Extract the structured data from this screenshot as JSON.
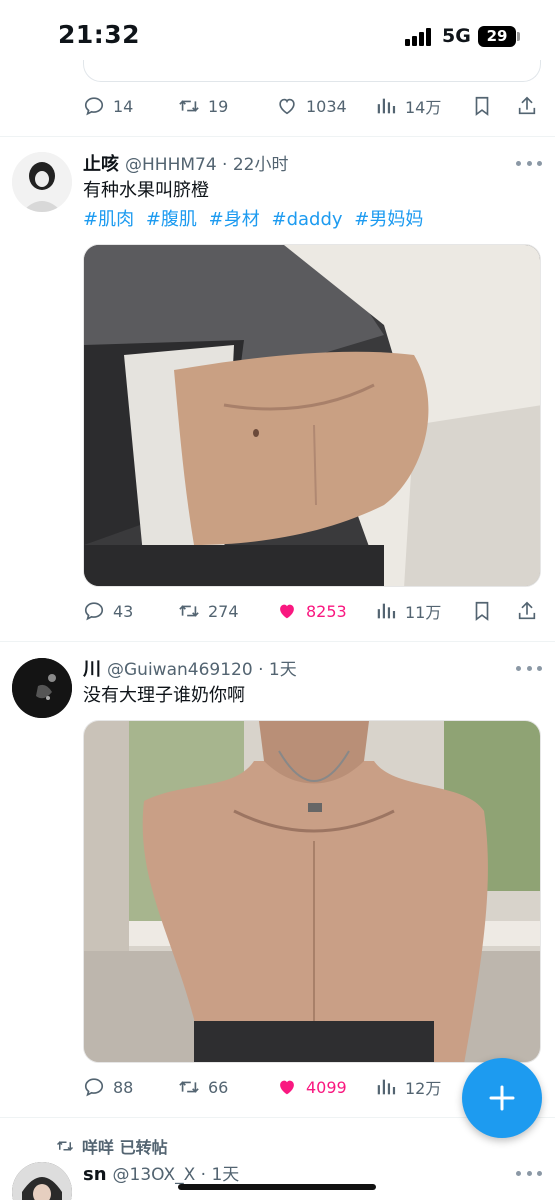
{
  "status_bar": {
    "time": "21:32",
    "network": "5G",
    "battery": "29"
  },
  "top_actions": {
    "replies": "14",
    "retweets": "19",
    "likes": "1034",
    "views": "14万"
  },
  "tweets": [
    {
      "author": "止咳",
      "meta": "@HHHM74 · 22小时",
      "text": "有种水果叫脐橙",
      "hashtags": [
        "#肌肉",
        "#腹肌",
        "#身材",
        "#daddy",
        "#男妈妈"
      ],
      "replies": "43",
      "retweets": "274",
      "likes": "8253",
      "views": "11万",
      "liked": true
    },
    {
      "author": "川",
      "meta": "@Guiwan469120 · 1天",
      "text": "没有大理子谁奶你啊",
      "replies": "88",
      "retweets": "66",
      "likes": "4099",
      "views": "12万",
      "liked": true
    },
    {
      "retweeted_by": "咩咩 已转帖",
      "author": "sn",
      "meta": "@13OX_X · 1天"
    }
  ],
  "colors": {
    "accent": "#1d9bf0",
    "like": "#f91880",
    "muted": "#536471"
  },
  "icons": [
    "reply-icon",
    "retweet-icon",
    "heart-icon",
    "views-icon",
    "bookmark-icon",
    "share-icon",
    "plus-icon",
    "more-icon"
  ]
}
